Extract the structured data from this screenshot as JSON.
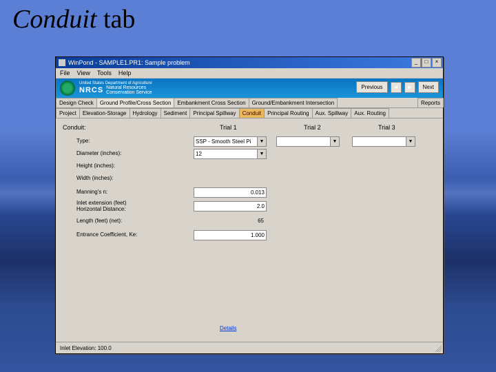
{
  "slide": {
    "title_italic": "Conduit",
    "title_rest": " tab"
  },
  "window": {
    "title": "WinPond - SAMPLE1.PR1: Sample problem",
    "min": "_",
    "max": "□",
    "close": "×"
  },
  "menu": {
    "file": "File",
    "view": "View",
    "tools": "Tools",
    "help": "Help"
  },
  "banner": {
    "org": "United States Department of Agriculture",
    "acronym": "NRCS",
    "name1": "Natural Resources",
    "name2": "Conservation Service",
    "prev": "Previous",
    "next": "Next",
    "arrow_l": "◄",
    "arrow_r": "►"
  },
  "tabs_row1": {
    "design": "Design Check",
    "ground": "Ground Profile/Cross Section",
    "embank": "Embankment Cross Section",
    "inter": "Ground/Embankment Intersection",
    "reports": "Reports"
  },
  "tabs_row2": {
    "project": "Project",
    "elev": "Elevation-Storage",
    "hydro": "Hydrology",
    "sed": "Sediment",
    "pspill": "Principal Spillway",
    "conduit": "Conduit",
    "prout": "Principal Routing",
    "aspill": "Aux. Spillway",
    "arout": "Aux. Routing"
  },
  "content": {
    "group": "Conduit:",
    "trial1": "Trial 1",
    "trial2": "Trial 2",
    "trial3": "Trial 3",
    "labels": {
      "type": "Type:",
      "diam": "Diameter (inches):",
      "height": "Height (inches):",
      "width": "Width (inches):",
      "mann": "Manning's n:",
      "inlet1": "Inlet extension (feet)",
      "inlet2": "Horizontal Distance:",
      "length": "Length (feet) (net):",
      "ent": "Entrance Coefficient, Ke:"
    },
    "values": {
      "type": "SSP  - Smooth Steel Pi",
      "diam": "12",
      "mann": "0.013",
      "inlet": "2.0",
      "length": "65",
      "ent": "1.000"
    },
    "link": "Details"
  },
  "status": {
    "text": "Inlet Elevation:  100.0"
  }
}
